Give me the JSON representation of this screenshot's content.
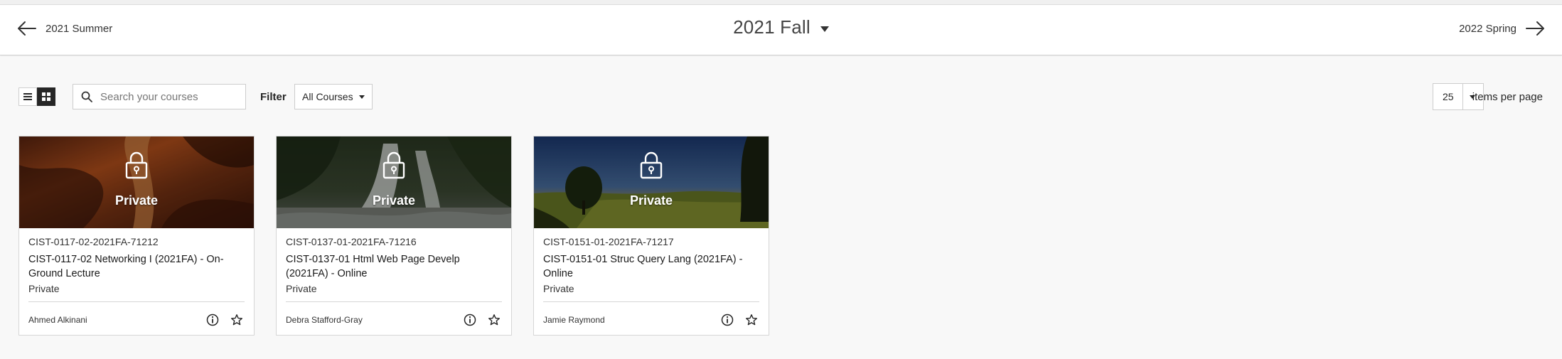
{
  "term_nav": {
    "previous_label": "2021 Summer",
    "current_label": "2021 Fall",
    "next_label": "2022 Spring"
  },
  "toolbar": {
    "view_modes": [
      "list",
      "grid"
    ],
    "active_view": "grid",
    "search_placeholder": "Search your courses",
    "filter_label": "Filter",
    "filter_value": "All Courses",
    "per_page_value": "25",
    "per_page_label": "items per page"
  },
  "courses": [
    {
      "banner_label": "Private",
      "course_id": "CIST-0117-02-2021FA-71212",
      "course_name": "CIST-0117-02 Networking I (2021FA) - On-Ground Lecture",
      "status": "Private",
      "instructor": "Ahmed Alkinani",
      "banner_theme": "canyon"
    },
    {
      "banner_label": "Private",
      "course_id": "CIST-0137-01-2021FA-71216",
      "course_name": "CIST-0137-01 Html Web Page Develp (2021FA) - Online",
      "status": "Private",
      "instructor": "Debra Stafford-Gray",
      "banner_theme": "waterfall"
    },
    {
      "banner_label": "Private",
      "course_id": "CIST-0151-01-2021FA-71217",
      "course_name": "CIST-0151-01 Struc Query Lang (2021FA) - Online",
      "status": "Private",
      "instructor": "Jamie Raymond",
      "banner_theme": "meadow"
    }
  ]
}
